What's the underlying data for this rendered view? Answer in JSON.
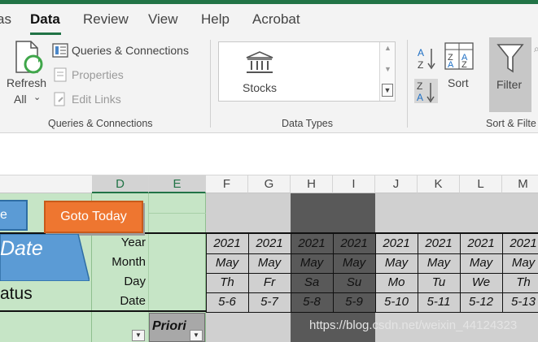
{
  "tabs": {
    "formulas_partial": "as",
    "data": "Data",
    "review": "Review",
    "view": "View",
    "help": "Help",
    "acrobat": "Acrobat"
  },
  "ribbon": {
    "refresh_all": [
      "Refresh",
      "All"
    ],
    "queries_connections": "Queries & Connections",
    "properties": "Properties",
    "edit_links": "Edit Links",
    "group_queries": "Queries & Connections",
    "stocks": "Stocks",
    "group_data_types": "Data Types",
    "sort": "Sort",
    "filter": "Filter",
    "group_sort_filter": "Sort & Filte",
    "sort_az_letters": [
      "A",
      "Z"
    ],
    "sort_za_letters": [
      "Z",
      "A"
    ]
  },
  "sheet": {
    "columns": [
      "D",
      "E",
      "F",
      "G",
      "H",
      "I",
      "J",
      "K",
      "L",
      "M"
    ],
    "row_labels": [
      "Year",
      "Month",
      "Day",
      "Date"
    ],
    "goto_today_button": "Goto Today",
    "left_button_partial": "e",
    "date_shape_text": "Date",
    "status_text": "atus",
    "priority_header": "Priori",
    "days": [
      {
        "year": "2021",
        "month": "May",
        "day": "Th",
        "date": "5-6",
        "weekend": false
      },
      {
        "year": "2021",
        "month": "May",
        "day": "Fr",
        "date": "5-7",
        "weekend": false
      },
      {
        "year": "2021",
        "month": "May",
        "day": "Sa",
        "date": "5-8",
        "weekend": true
      },
      {
        "year": "2021",
        "month": "May",
        "day": "Su",
        "date": "5-9",
        "weekend": true
      },
      {
        "year": "2021",
        "month": "May",
        "day": "Mo",
        "date": "5-10",
        "weekend": false
      },
      {
        "year": "2021",
        "month": "May",
        "day": "Tu",
        "date": "5-11",
        "weekend": false
      },
      {
        "year": "2021",
        "month": "May",
        "day": "We",
        "date": "5-12",
        "weekend": false
      },
      {
        "year": "2021",
        "month": "May",
        "day": "Th",
        "date": "5-13",
        "weekend": false
      }
    ]
  },
  "watermark": "https://blog.csdn.net/weixin_44124323",
  "colors": {
    "excel_green": "#217346",
    "goto_button": "#ee7630",
    "blue_shape": "#5b9bd5",
    "light_green_fill": "#c6e5c6",
    "weekend_gray": "#595959",
    "weekday_gray": "#d0d0d0"
  }
}
